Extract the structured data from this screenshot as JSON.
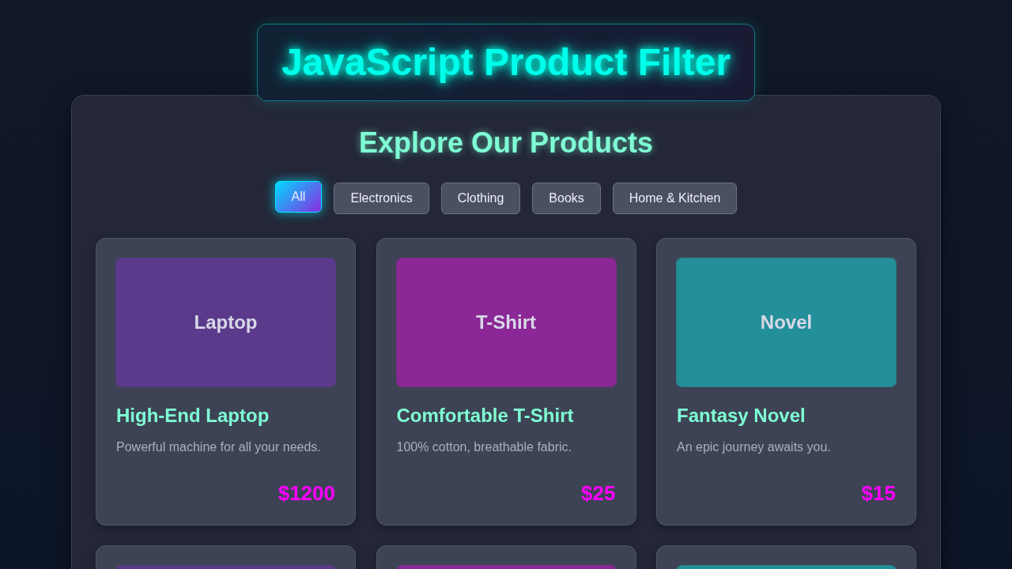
{
  "header": {
    "title": "JavaScript Product Filter"
  },
  "section_title": "Explore Our Products",
  "filters": [
    {
      "label": "All",
      "selected": true
    },
    {
      "label": "Electronics",
      "selected": false
    },
    {
      "label": "Clothing",
      "selected": false
    },
    {
      "label": "Books",
      "selected": false
    },
    {
      "label": "Home & Kitchen",
      "selected": false
    }
  ],
  "products": [
    {
      "image_label": "Laptop",
      "color": "#5b3a8c",
      "name": "High-End Laptop",
      "description": "Powerful machine for all your needs.",
      "price": "$1200"
    },
    {
      "image_label": "T-Shirt",
      "color": "#8b2796",
      "name": "Comfortable T-Shirt",
      "description": "100% cotton, breathable fabric.",
      "price": "$25"
    },
    {
      "image_label": "Novel",
      "color": "#238f99",
      "name": "Fantasy Novel",
      "description": "An epic journey awaits you.",
      "price": "$15"
    },
    {
      "color": "#5b3a8c"
    },
    {
      "color": "#8b2796"
    },
    {
      "color": "#238f99"
    }
  ]
}
